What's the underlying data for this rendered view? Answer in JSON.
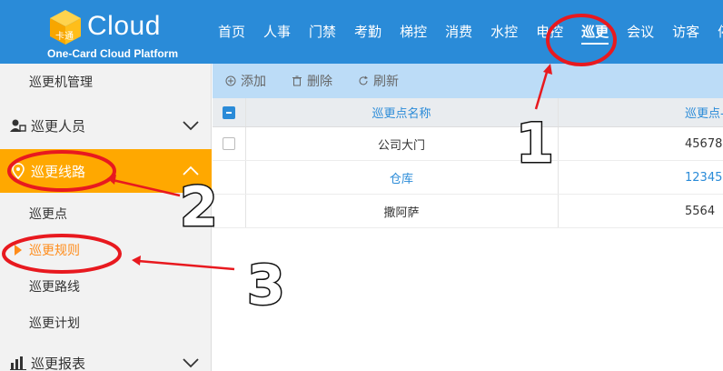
{
  "brand": {
    "logo_word": "Cloud",
    "subtitle": "One-Card Cloud Platform",
    "cube_text": "卡通"
  },
  "nav": {
    "items": [
      "首页",
      "人事",
      "门禁",
      "考勤",
      "梯控",
      "消费",
      "水控",
      "电控",
      "巡更",
      "会议",
      "访客",
      "停"
    ],
    "active_index": 8
  },
  "sidebar": {
    "groups": [
      {
        "label": "巡更机管理",
        "icon": ""
      },
      {
        "label": "巡更人员",
        "icon": "person-card-icon"
      },
      {
        "label": "巡更线路",
        "icon": "map-pin-icon"
      },
      {
        "label": "巡更报表",
        "icon": "bar-chart-icon"
      }
    ],
    "sub_items": [
      "巡更点",
      "巡更规则",
      "巡更路线",
      "巡更计划"
    ],
    "active_group": "巡更线路",
    "current_sub": "巡更规则"
  },
  "toolbar": {
    "add_label": "添加",
    "delete_label": "删除",
    "refresh_label": "刷新"
  },
  "table": {
    "columns": [
      "巡更点名称",
      "巡更点-"
    ],
    "rows": [
      {
        "name": "公司大门",
        "code": "45678",
        "selected": false
      },
      {
        "name": "仓库",
        "code": "12345",
        "selected": false
      },
      {
        "name": "撒阿萨",
        "code": "5564",
        "selected": false
      }
    ]
  },
  "annotations": {
    "numbers": [
      "1",
      "2",
      "3"
    ],
    "color": "#e8191f"
  },
  "colors": {
    "topbar": "#2a8bd8",
    "sidebar_active": "#ffa800",
    "current_text": "#ff8c1a",
    "toolbar": "#bcdcf7"
  }
}
